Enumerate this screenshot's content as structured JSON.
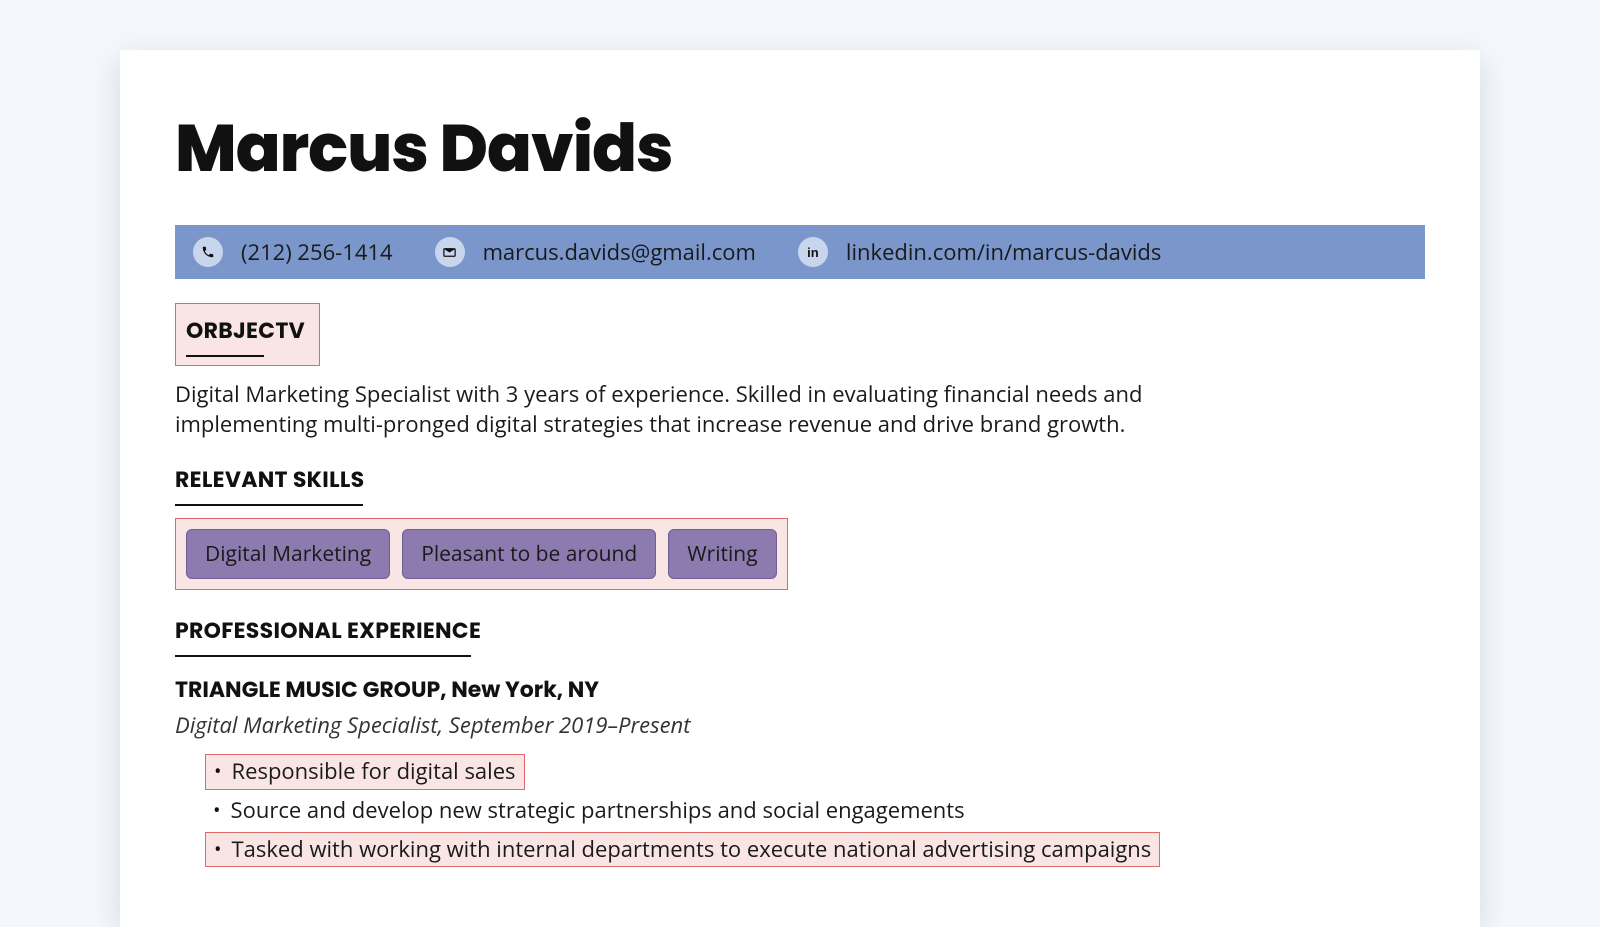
{
  "name": "Marcus Davids",
  "contact": {
    "phone": "(212) 256-1414",
    "email": "marcus.davids@gmail.com",
    "linkedin": "linkedin.com/in/marcus-davids",
    "icons": {
      "phone": "phone",
      "email": "email",
      "linkedin": "in"
    }
  },
  "sections": {
    "objective_heading": "ORBJECTV",
    "objective_text": "Digital Marketing Specialist with 3 years of experience. Skilled in evaluating financial needs and implementing multi-pronged digital strategies that increase revenue and drive brand growth.",
    "skills_heading": "RELEVANT SKILLS",
    "skills": [
      "Digital Marketing",
      "Pleasant to be around",
      "Writing"
    ],
    "experience_heading": "PROFESSIONAL EXPERIENCE",
    "job": {
      "company_line": "TRIANGLE MUSIC GROUP, New York, NY",
      "role_line": "Digital Marketing Specialist, September 2019–Present",
      "bullets": [
        {
          "text": "Responsible for digital sales",
          "highlight": true
        },
        {
          "text": "Source and develop new strategic partnerships and social engagements",
          "highlight": false
        },
        {
          "text": "Tasked with working with internal departments to execute national advertising campaigns",
          "highlight": true
        }
      ]
    }
  }
}
